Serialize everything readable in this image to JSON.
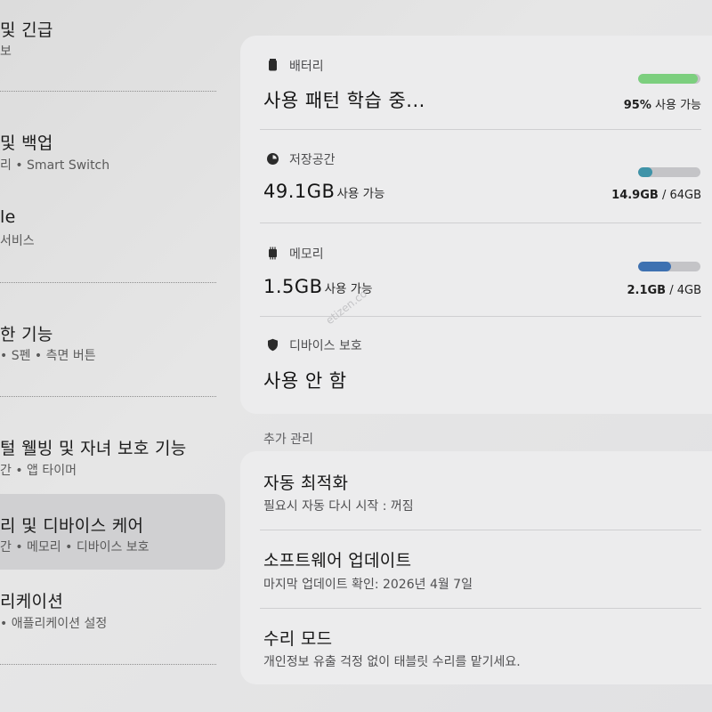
{
  "left_menu": [
    {
      "title": "및 긴급",
      "subtitle": "보"
    },
    {
      "title": "및 백업",
      "subtitle": "리 • Smart Switch"
    },
    {
      "title": "le",
      "subtitle": "서비스"
    },
    {
      "title": "한 기능",
      "subtitle": "• S펜 • 측면 버튼"
    },
    {
      "title": "털 웰빙 및 자녀 보호 기능",
      "subtitle": "간 • 앱 타이머"
    },
    {
      "title": "리 및 디바이스 케어",
      "subtitle": "간 • 메모리 • 디바이스 보호"
    },
    {
      "title": "리케이션",
      "subtitle": "• 애플리케이션 설정"
    }
  ],
  "battery": {
    "label": "배터리",
    "icon": "battery-icon",
    "value": "사용 패턴 학습 중...",
    "percent_text": "95%",
    "status_text": " 사용 가능",
    "level": 0.95,
    "color": "#7ccf7e"
  },
  "storage": {
    "label": "저장공간",
    "icon": "pie-chart-icon",
    "value": "49.1GB",
    "unit": "사용 가능",
    "used": "14.9GB",
    "total": " / 64GB",
    "level": 0.233,
    "color": "#3f93a8"
  },
  "memory": {
    "label": "메모리",
    "icon": "memory-chip-icon",
    "value": "1.5GB",
    "unit": "사용 가능",
    "used": "2.1GB",
    "total": " / 4GB",
    "level": 0.525,
    "color": "#3e71b1"
  },
  "protection": {
    "label": "디바이스 보호",
    "icon": "shield-icon",
    "value": "사용 안 함"
  },
  "watermark": "etizen.co",
  "additional": {
    "header": "추가 관리",
    "items": [
      {
        "title": "자동 최적화",
        "subtitle": "필요시 자동 다시 시작 : 꺼짐"
      },
      {
        "title": "소프트웨어 업데이트",
        "subtitle": "마지막 업데이트 확인: 2026년 4월 7일"
      },
      {
        "title": "수리 모드",
        "subtitle": "개인정보 유출 걱정 없이 태블릿 수리를 맡기세요."
      }
    ]
  }
}
